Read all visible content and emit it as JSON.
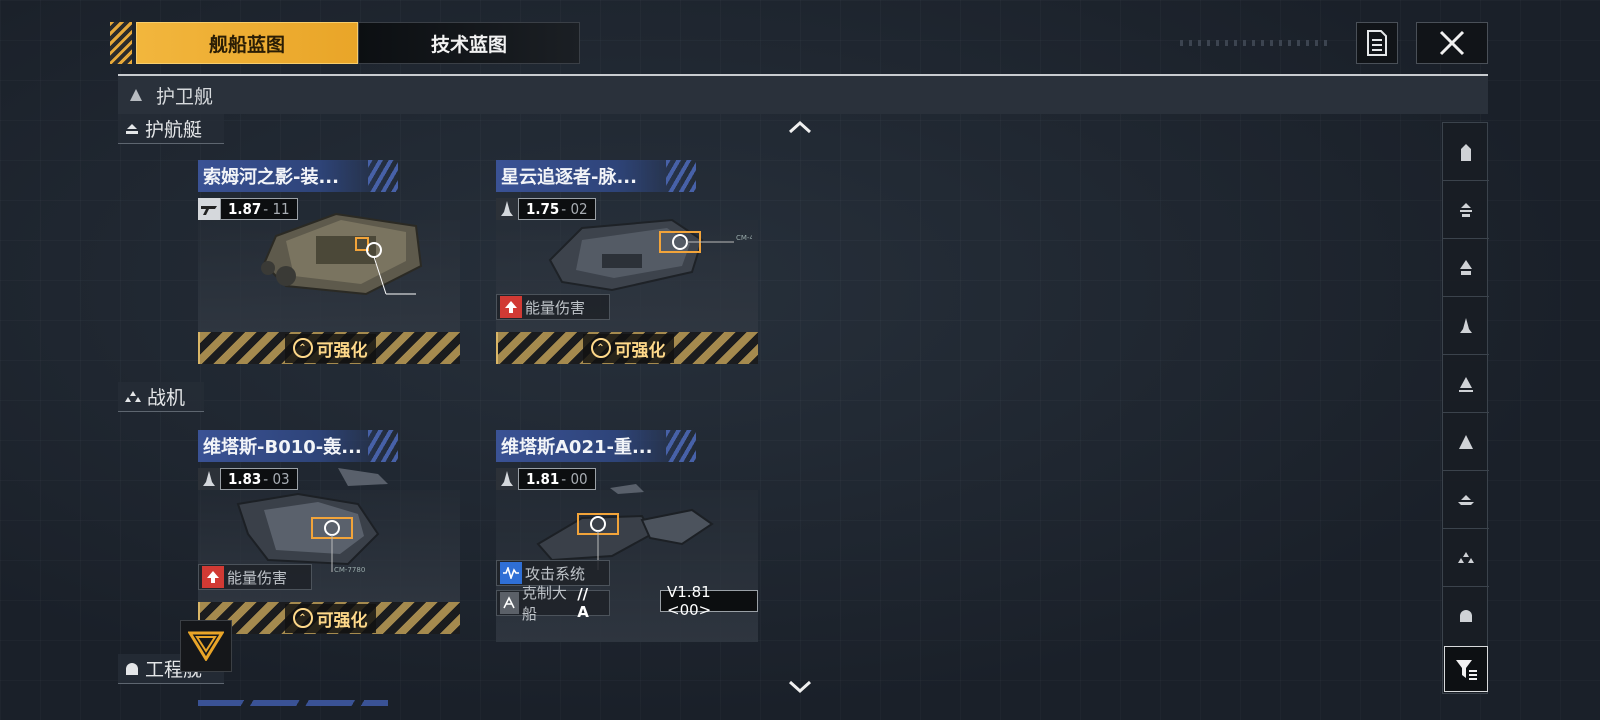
{
  "tabs": [
    {
      "label": "舰船蓝图",
      "active": true
    },
    {
      "label": "技术蓝图",
      "active": false
    }
  ],
  "header": {
    "doc_icon": "document-icon",
    "close_icon": "close-icon"
  },
  "category": {
    "label": "护卫舰"
  },
  "sections": [
    {
      "label": "护航艇",
      "icon": "escort-icon"
    },
    {
      "label": "战机",
      "icon": "fighter-icon"
    },
    {
      "label": "工程舰",
      "icon": "engineering-icon"
    }
  ],
  "cards": [
    {
      "name": "索姆河之影-装...",
      "version_main": "1.87",
      "version_sub": "- 11",
      "upgrade_label": "可强化",
      "tag": "",
      "ship_note": "",
      "engraving_label": ""
    },
    {
      "name": "星云追逐者-脉...",
      "version_main": "1.75",
      "version_sub": "- 02",
      "upgrade_label": "可强化",
      "tag": "能量伤害",
      "ship_note": "CM-4s1200",
      "engraving_label": ""
    },
    {
      "name": "维塔斯-B010-轰...",
      "version_main": "1.83",
      "version_sub": "- 03",
      "upgrade_label": "可强化",
      "tag": "能量伤害",
      "ship_note": "CM-7780",
      "engraving_label": ""
    },
    {
      "name": "维塔斯A021-重...",
      "version_main": "1.81",
      "version_sub": "- 00",
      "upgrade_label": "",
      "tag": "攻击系统",
      "ship_note": "",
      "counter_label": "克制大船",
      "counter_grade": "// A",
      "version_badge": "V1.81 <00>"
    }
  ],
  "right_filters": [
    "all-icon",
    "escort-icon",
    "frigate-icon",
    "destroyer-icon",
    "cruiser-icon",
    "battlecruiser-icon",
    "carrier-icon",
    "fighter-icon",
    "engineering-icon"
  ],
  "filter_button_icon": "filter-icon",
  "colors": {
    "accent": "#f2b63d",
    "title_blue": "#3a5295",
    "upgrade_gold": "#ffd98a",
    "tag_red": "#d13a34",
    "tag_blue": "#2f6fd6"
  }
}
